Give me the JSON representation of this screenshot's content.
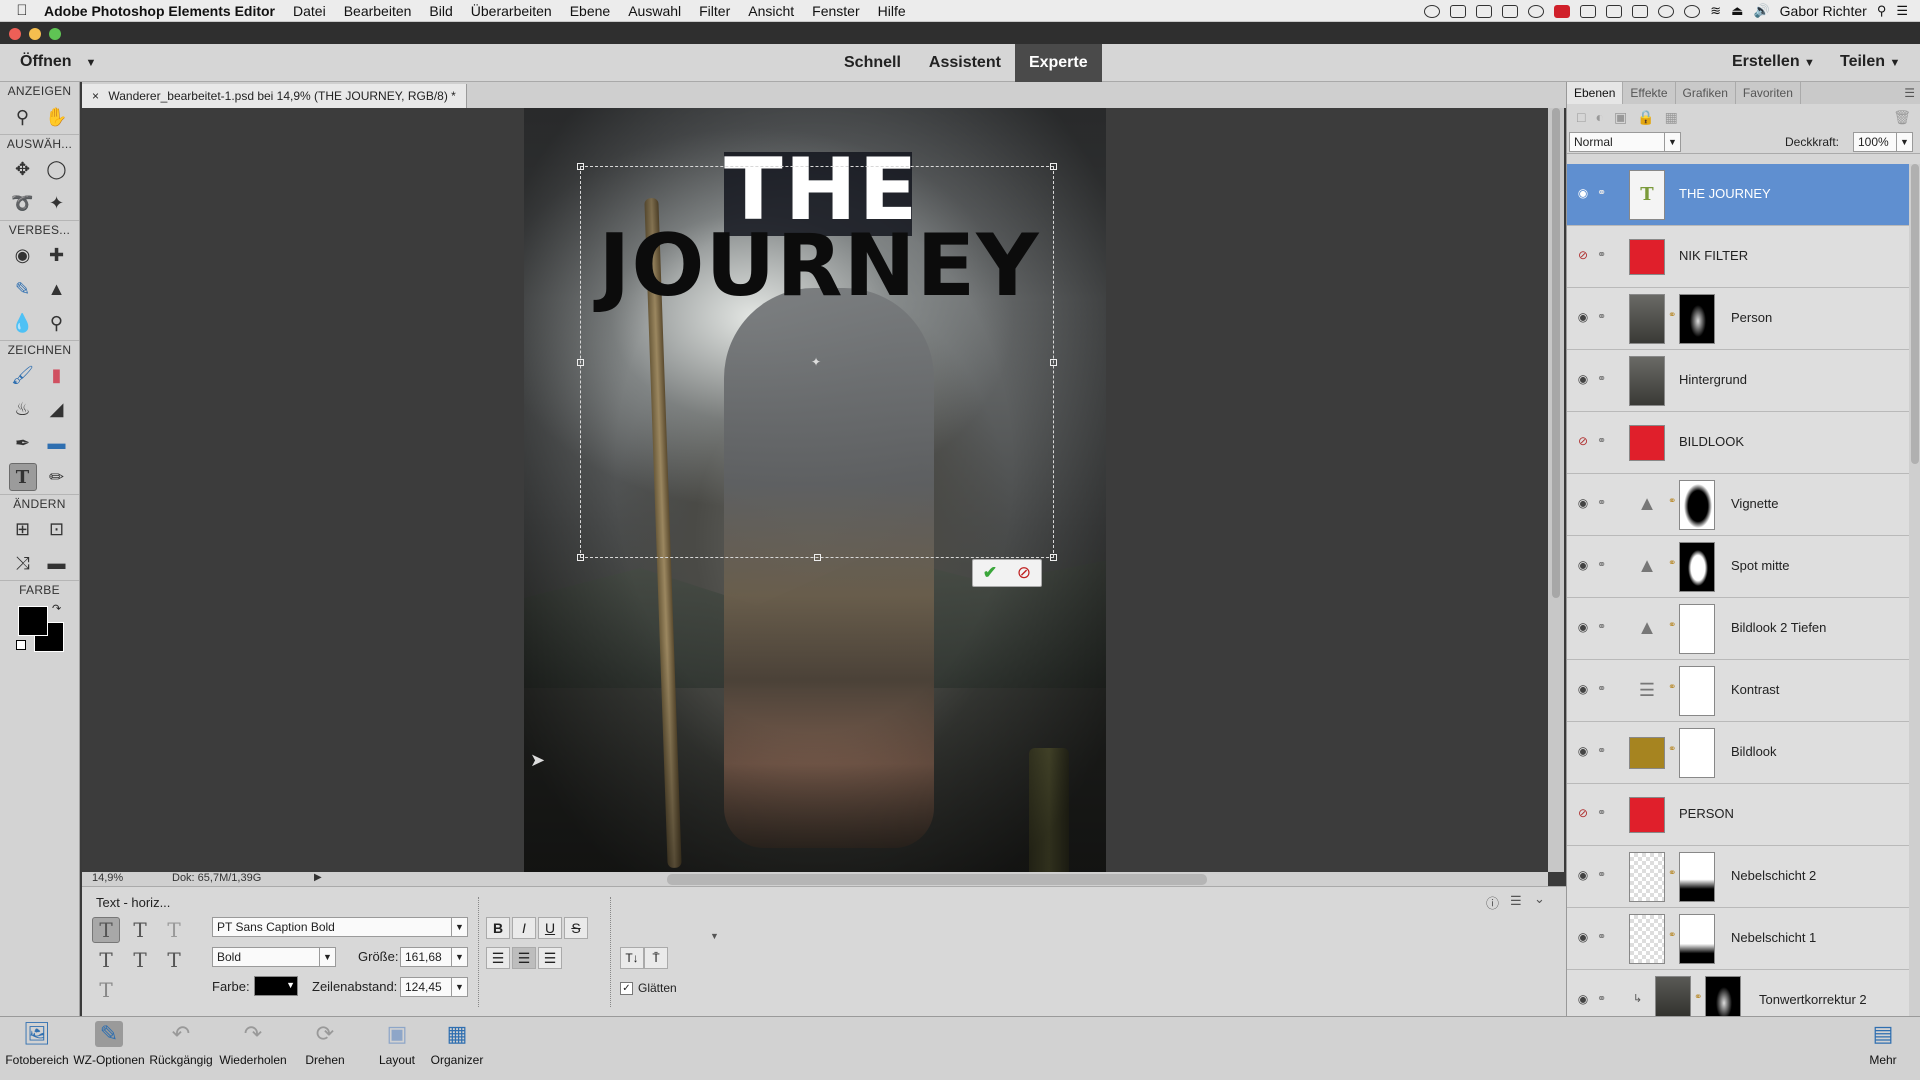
{
  "menubar": {
    "app_name": "Adobe Photoshop Elements Editor",
    "items": [
      "Datei",
      "Bearbeiten",
      "Bild",
      "Überarbeiten",
      "Ebene",
      "Auswahl",
      "Filter",
      "Ansicht",
      "Fenster",
      "Hilfe"
    ],
    "user": "Gabor Richter"
  },
  "modebar": {
    "open_label": "Öffnen",
    "modes": [
      "Schnell",
      "Assistent",
      "Experte"
    ],
    "active_mode": "Experte",
    "create_label": "Erstellen",
    "share_label": "Teilen"
  },
  "toolbox": {
    "sections": [
      "ANZEIGEN",
      "AUSWÄH...",
      "VERBES...",
      "ZEICHNEN",
      "ÄNDERN",
      "FARBE"
    ]
  },
  "document": {
    "tab_title": "Wanderer_bearbeitet-1.psd bei 14,9% (THE JOURNEY, RGB/8) *",
    "close": "×",
    "text_line1": "THE",
    "text_line2": "JOURNEY"
  },
  "statusbar": {
    "zoom": "14,9%",
    "doc_size": "Dok: 65,7M/1,39G"
  },
  "options": {
    "tool_name": "Text - horiz...",
    "font_family": "PT Sans Caption Bold",
    "font_style": "Bold",
    "size_label": "Größe:",
    "size_value": "161,68",
    "color_label": "Farbe:",
    "leading_label": "Zeilenabstand:",
    "leading_value": "124,45",
    "bold": "B",
    "italic": "I",
    "underline": "U",
    "strike": "S",
    "antialias_label": "Glätten",
    "antialias_checked": true
  },
  "taskbar": {
    "items": [
      "Fotobereich",
      "WZ-Optionen",
      "Rückgängig",
      "Wiederholen",
      "Drehen",
      "Layout",
      "Organizer"
    ],
    "more_label": "Mehr"
  },
  "panel": {
    "tabs": [
      "Ebenen",
      "Effekte",
      "Grafiken",
      "Favoriten"
    ],
    "active_tab": "Ebenen",
    "blend_mode": "Normal",
    "opacity_label": "Deckkraft:",
    "opacity_value": "100%",
    "layers": [
      {
        "name": "THE JOURNEY",
        "kind": "text",
        "visible": true,
        "selected": true
      },
      {
        "name": "NIK FILTER",
        "kind": "group",
        "visible": false,
        "selected": false
      },
      {
        "name": "Person",
        "kind": "photo-mask",
        "visible": true,
        "selected": false
      },
      {
        "name": "Hintergrund",
        "kind": "photo",
        "visible": true,
        "selected": false
      },
      {
        "name": "BILDLOOK",
        "kind": "group",
        "visible": false,
        "selected": false
      },
      {
        "name": "Vignette",
        "kind": "levels-mask",
        "visible": true,
        "selected": false
      },
      {
        "name": "Spot mitte",
        "kind": "levels-mask",
        "visible": true,
        "selected": false
      },
      {
        "name": "Bildlook 2 Tiefen",
        "kind": "levels-mask",
        "visible": true,
        "selected": false
      },
      {
        "name": "Kontrast",
        "kind": "adjust-mask",
        "visible": true,
        "selected": false
      },
      {
        "name": "Bildlook",
        "kind": "fill-mask",
        "visible": true,
        "selected": false
      },
      {
        "name": "PERSON",
        "kind": "group",
        "visible": false,
        "selected": false
      },
      {
        "name": "Nebelschicht 2",
        "kind": "empty-mask",
        "visible": true,
        "selected": false
      },
      {
        "name": "Nebelschicht 1",
        "kind": "empty-mask",
        "visible": true,
        "selected": false
      },
      {
        "name": "Tonwertkorrektur 2",
        "kind": "photo-mask",
        "visible": true,
        "selected": false
      }
    ]
  },
  "colors": {
    "selected_layer": "#5f8fd0",
    "group_red": "#e01f2b",
    "fill_gold": "#a68420",
    "active_mode_bg": "#4a4a4a"
  }
}
